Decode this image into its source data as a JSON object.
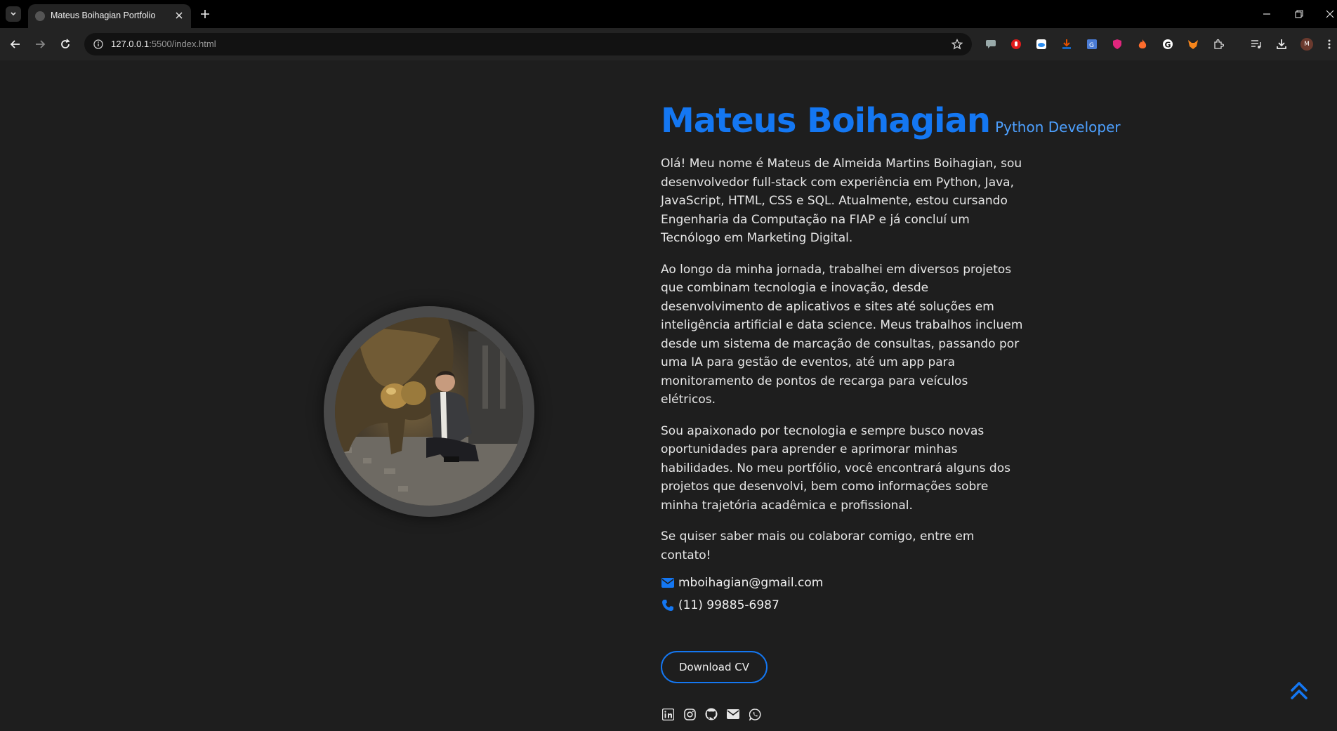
{
  "browser": {
    "tab_title": "Mateus Boihagian Portfolio",
    "url_host": "127.0.0.1",
    "url_rest": ":5500/index.html",
    "profile_initial": "M"
  },
  "hero": {
    "name": "Mateus Boihagian",
    "role": "Python Developer",
    "photo_alt": "Mateus Boihagian"
  },
  "bio": {
    "p1": "Olá! Meu nome é Mateus de Almeida Martins Boihagian, sou desenvolvedor full-stack com experiência em Python, Java, JavaScript, HTML, CSS e SQL. Atualmente, estou cursando Engenharia da Computação na FIAP e já concluí um Tecnólogo em Marketing Digital.",
    "p2": "Ao longo da minha jornada, trabalhei em diversos projetos que combinam tecnologia e inovação, desde desenvolvimento de aplicativos e sites até soluções em inteligência artificial e data science. Meus trabalhos incluem desde um sistema de marcação de consultas, passando por uma IA para gestão de eventos, até um app para monitoramento de pontos de recarga para veículos elétricos.",
    "p3": "Sou apaixonado por tecnologia e sempre busco novas oportunidades para aprender e aprimorar minhas habilidades. No meu portfólio, você encontrará alguns dos projetos que desenvolvi, bem como informações sobre minha trajetória acadêmica e profissional.",
    "p4": "Se quiser saber mais ou colaborar comigo, entre em contato!"
  },
  "contact": {
    "email": "mboihagian@gmail.com",
    "phone": "(11) 99885-6987"
  },
  "cv_button": "Download CV",
  "colors": {
    "accent": "#1477f2",
    "background": "#1e1e1e",
    "text": "#e6e6e6"
  }
}
